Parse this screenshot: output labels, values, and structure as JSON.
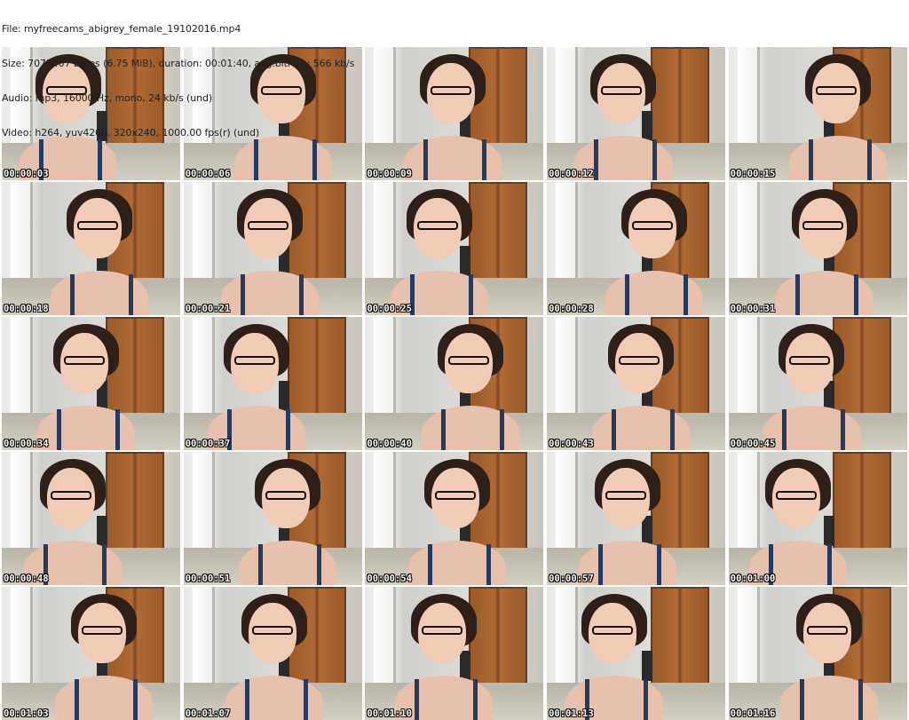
{
  "header": {
    "file": "File: myfreecams_abigrey_female_19102016.mp4",
    "size": "Size: 7073407 bytes (6.75 MiB), duration: 00:01:40, avg.bitrate: 566 kb/s",
    "audio": "Audio: mp3, 16000 Hz, mono, 24 kb/s (und)",
    "video": "Video: h264, yuv420p, 320x240, 1000.00 fps(r) (und)"
  },
  "thumbnails": [
    "00:00:03",
    "00:00:06",
    "00:00:09",
    "00:00:12",
    "00:00:15",
    "00:00:18",
    "00:00:21",
    "00:00:25",
    "00:00:28",
    "00:00:31",
    "00:00:34",
    "00:00:37",
    "00:00:40",
    "00:00:43",
    "00:00:45",
    "00:00:48",
    "00:00:51",
    "00:00:54",
    "00:00:57",
    "00:01:00",
    "00:01:03",
    "00:01:07",
    "00:01:10",
    "00:01:13",
    "00:01:16"
  ]
}
